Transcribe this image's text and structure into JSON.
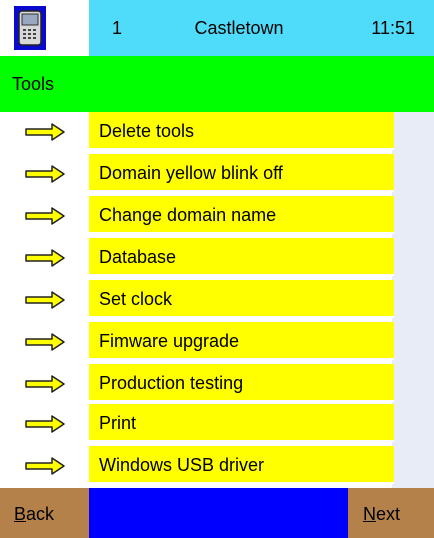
{
  "header": {
    "number": "1",
    "location": "Castletown",
    "time": "11:51",
    "icon": "device-icon"
  },
  "title": "Tools",
  "menu": [
    {
      "label": "Delete tools"
    },
    {
      "label": "Domain yellow blink off"
    },
    {
      "label": "Change domain name"
    },
    {
      "label": "Database"
    },
    {
      "label": "Set clock"
    },
    {
      "label": "Fimware upgrade"
    },
    {
      "label": "Production testing"
    },
    {
      "label": "Print"
    },
    {
      "label": "Windows USB driver"
    }
  ],
  "footer": {
    "back": {
      "first": "B",
      "rest": "ack"
    },
    "next": {
      "first": "N",
      "rest": "ext"
    }
  },
  "colors": {
    "header": "#4fdcfa",
    "title_bar": "#00ff00",
    "menu_button": "#ffff00",
    "nav_button": "#b5814a",
    "footer_mid": "#0000ff"
  }
}
